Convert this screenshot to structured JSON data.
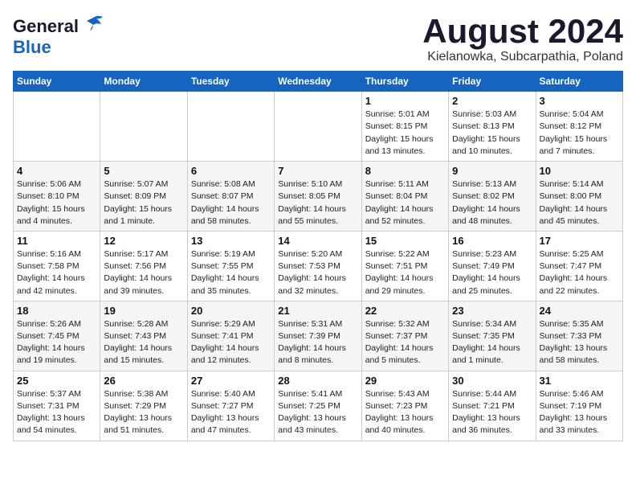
{
  "header": {
    "logo_general": "General",
    "logo_blue": "Blue",
    "month_year": "August 2024",
    "location": "Kielanowka, Subcarpathia, Poland"
  },
  "days_of_week": [
    "Sunday",
    "Monday",
    "Tuesday",
    "Wednesday",
    "Thursday",
    "Friday",
    "Saturday"
  ],
  "weeks": [
    [
      {
        "day": "",
        "info": ""
      },
      {
        "day": "",
        "info": ""
      },
      {
        "day": "",
        "info": ""
      },
      {
        "day": "",
        "info": ""
      },
      {
        "day": "1",
        "info": "Sunrise: 5:01 AM\nSunset: 8:15 PM\nDaylight: 15 hours\nand 13 minutes."
      },
      {
        "day": "2",
        "info": "Sunrise: 5:03 AM\nSunset: 8:13 PM\nDaylight: 15 hours\nand 10 minutes."
      },
      {
        "day": "3",
        "info": "Sunrise: 5:04 AM\nSunset: 8:12 PM\nDaylight: 15 hours\nand 7 minutes."
      }
    ],
    [
      {
        "day": "4",
        "info": "Sunrise: 5:06 AM\nSunset: 8:10 PM\nDaylight: 15 hours\nand 4 minutes."
      },
      {
        "day": "5",
        "info": "Sunrise: 5:07 AM\nSunset: 8:09 PM\nDaylight: 15 hours\nand 1 minute."
      },
      {
        "day": "6",
        "info": "Sunrise: 5:08 AM\nSunset: 8:07 PM\nDaylight: 14 hours\nand 58 minutes."
      },
      {
        "day": "7",
        "info": "Sunrise: 5:10 AM\nSunset: 8:05 PM\nDaylight: 14 hours\nand 55 minutes."
      },
      {
        "day": "8",
        "info": "Sunrise: 5:11 AM\nSunset: 8:04 PM\nDaylight: 14 hours\nand 52 minutes."
      },
      {
        "day": "9",
        "info": "Sunrise: 5:13 AM\nSunset: 8:02 PM\nDaylight: 14 hours\nand 48 minutes."
      },
      {
        "day": "10",
        "info": "Sunrise: 5:14 AM\nSunset: 8:00 PM\nDaylight: 14 hours\nand 45 minutes."
      }
    ],
    [
      {
        "day": "11",
        "info": "Sunrise: 5:16 AM\nSunset: 7:58 PM\nDaylight: 14 hours\nand 42 minutes."
      },
      {
        "day": "12",
        "info": "Sunrise: 5:17 AM\nSunset: 7:56 PM\nDaylight: 14 hours\nand 39 minutes."
      },
      {
        "day": "13",
        "info": "Sunrise: 5:19 AM\nSunset: 7:55 PM\nDaylight: 14 hours\nand 35 minutes."
      },
      {
        "day": "14",
        "info": "Sunrise: 5:20 AM\nSunset: 7:53 PM\nDaylight: 14 hours\nand 32 minutes."
      },
      {
        "day": "15",
        "info": "Sunrise: 5:22 AM\nSunset: 7:51 PM\nDaylight: 14 hours\nand 29 minutes."
      },
      {
        "day": "16",
        "info": "Sunrise: 5:23 AM\nSunset: 7:49 PM\nDaylight: 14 hours\nand 25 minutes."
      },
      {
        "day": "17",
        "info": "Sunrise: 5:25 AM\nSunset: 7:47 PM\nDaylight: 14 hours\nand 22 minutes."
      }
    ],
    [
      {
        "day": "18",
        "info": "Sunrise: 5:26 AM\nSunset: 7:45 PM\nDaylight: 14 hours\nand 19 minutes."
      },
      {
        "day": "19",
        "info": "Sunrise: 5:28 AM\nSunset: 7:43 PM\nDaylight: 14 hours\nand 15 minutes."
      },
      {
        "day": "20",
        "info": "Sunrise: 5:29 AM\nSunset: 7:41 PM\nDaylight: 14 hours\nand 12 minutes."
      },
      {
        "day": "21",
        "info": "Sunrise: 5:31 AM\nSunset: 7:39 PM\nDaylight: 14 hours\nand 8 minutes."
      },
      {
        "day": "22",
        "info": "Sunrise: 5:32 AM\nSunset: 7:37 PM\nDaylight: 14 hours\nand 5 minutes."
      },
      {
        "day": "23",
        "info": "Sunrise: 5:34 AM\nSunset: 7:35 PM\nDaylight: 14 hours\nand 1 minute."
      },
      {
        "day": "24",
        "info": "Sunrise: 5:35 AM\nSunset: 7:33 PM\nDaylight: 13 hours\nand 58 minutes."
      }
    ],
    [
      {
        "day": "25",
        "info": "Sunrise: 5:37 AM\nSunset: 7:31 PM\nDaylight: 13 hours\nand 54 minutes."
      },
      {
        "day": "26",
        "info": "Sunrise: 5:38 AM\nSunset: 7:29 PM\nDaylight: 13 hours\nand 51 minutes."
      },
      {
        "day": "27",
        "info": "Sunrise: 5:40 AM\nSunset: 7:27 PM\nDaylight: 13 hours\nand 47 minutes."
      },
      {
        "day": "28",
        "info": "Sunrise: 5:41 AM\nSunset: 7:25 PM\nDaylight: 13 hours\nand 43 minutes."
      },
      {
        "day": "29",
        "info": "Sunrise: 5:43 AM\nSunset: 7:23 PM\nDaylight: 13 hours\nand 40 minutes."
      },
      {
        "day": "30",
        "info": "Sunrise: 5:44 AM\nSunset: 7:21 PM\nDaylight: 13 hours\nand 36 minutes."
      },
      {
        "day": "31",
        "info": "Sunrise: 5:46 AM\nSunset: 7:19 PM\nDaylight: 13 hours\nand 33 minutes."
      }
    ]
  ]
}
